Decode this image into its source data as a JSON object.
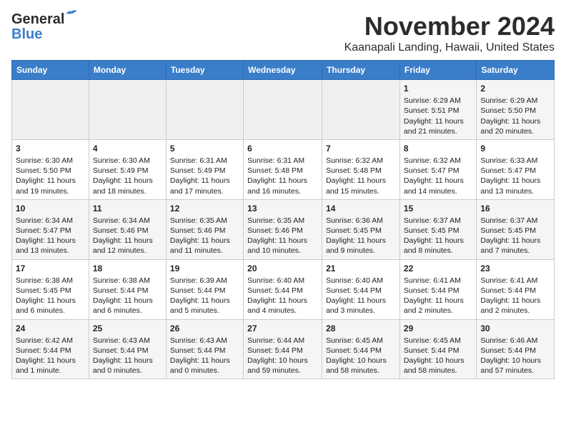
{
  "logo": {
    "line1": "General",
    "line2": "Blue"
  },
  "header": {
    "month": "November 2024",
    "location": "Kaanapali Landing, Hawaii, United States"
  },
  "columns": [
    "Sunday",
    "Monday",
    "Tuesday",
    "Wednesday",
    "Thursday",
    "Friday",
    "Saturday"
  ],
  "weeks": [
    [
      {
        "day": "",
        "empty": true
      },
      {
        "day": "",
        "empty": true
      },
      {
        "day": "",
        "empty": true
      },
      {
        "day": "",
        "empty": true
      },
      {
        "day": "",
        "empty": true
      },
      {
        "day": "1",
        "sunrise": "6:29 AM",
        "sunset": "5:51 PM",
        "daylight": "11 hours and 21 minutes."
      },
      {
        "day": "2",
        "sunrise": "6:29 AM",
        "sunset": "5:50 PM",
        "daylight": "11 hours and 20 minutes."
      }
    ],
    [
      {
        "day": "3",
        "sunrise": "6:30 AM",
        "sunset": "5:50 PM",
        "daylight": "11 hours and 19 minutes."
      },
      {
        "day": "4",
        "sunrise": "6:30 AM",
        "sunset": "5:49 PM",
        "daylight": "11 hours and 18 minutes."
      },
      {
        "day": "5",
        "sunrise": "6:31 AM",
        "sunset": "5:49 PM",
        "daylight": "11 hours and 17 minutes."
      },
      {
        "day": "6",
        "sunrise": "6:31 AM",
        "sunset": "5:48 PM",
        "daylight": "11 hours and 16 minutes."
      },
      {
        "day": "7",
        "sunrise": "6:32 AM",
        "sunset": "5:48 PM",
        "daylight": "11 hours and 15 minutes."
      },
      {
        "day": "8",
        "sunrise": "6:32 AM",
        "sunset": "5:47 PM",
        "daylight": "11 hours and 14 minutes."
      },
      {
        "day": "9",
        "sunrise": "6:33 AM",
        "sunset": "5:47 PM",
        "daylight": "11 hours and 13 minutes."
      }
    ],
    [
      {
        "day": "10",
        "sunrise": "6:34 AM",
        "sunset": "5:47 PM",
        "daylight": "11 hours and 13 minutes."
      },
      {
        "day": "11",
        "sunrise": "6:34 AM",
        "sunset": "5:46 PM",
        "daylight": "11 hours and 12 minutes."
      },
      {
        "day": "12",
        "sunrise": "6:35 AM",
        "sunset": "5:46 PM",
        "daylight": "11 hours and 11 minutes."
      },
      {
        "day": "13",
        "sunrise": "6:35 AM",
        "sunset": "5:46 PM",
        "daylight": "11 hours and 10 minutes."
      },
      {
        "day": "14",
        "sunrise": "6:36 AM",
        "sunset": "5:45 PM",
        "daylight": "11 hours and 9 minutes."
      },
      {
        "day": "15",
        "sunrise": "6:37 AM",
        "sunset": "5:45 PM",
        "daylight": "11 hours and 8 minutes."
      },
      {
        "day": "16",
        "sunrise": "6:37 AM",
        "sunset": "5:45 PM",
        "daylight": "11 hours and 7 minutes."
      }
    ],
    [
      {
        "day": "17",
        "sunrise": "6:38 AM",
        "sunset": "5:45 PM",
        "daylight": "11 hours and 6 minutes."
      },
      {
        "day": "18",
        "sunrise": "6:38 AM",
        "sunset": "5:44 PM",
        "daylight": "11 hours and 6 minutes."
      },
      {
        "day": "19",
        "sunrise": "6:39 AM",
        "sunset": "5:44 PM",
        "daylight": "11 hours and 5 minutes."
      },
      {
        "day": "20",
        "sunrise": "6:40 AM",
        "sunset": "5:44 PM",
        "daylight": "11 hours and 4 minutes."
      },
      {
        "day": "21",
        "sunrise": "6:40 AM",
        "sunset": "5:44 PM",
        "daylight": "11 hours and 3 minutes."
      },
      {
        "day": "22",
        "sunrise": "6:41 AM",
        "sunset": "5:44 PM",
        "daylight": "11 hours and 2 minutes."
      },
      {
        "day": "23",
        "sunrise": "6:41 AM",
        "sunset": "5:44 PM",
        "daylight": "11 hours and 2 minutes."
      }
    ],
    [
      {
        "day": "24",
        "sunrise": "6:42 AM",
        "sunset": "5:44 PM",
        "daylight": "11 hours and 1 minute."
      },
      {
        "day": "25",
        "sunrise": "6:43 AM",
        "sunset": "5:44 PM",
        "daylight": "11 hours and 0 minutes."
      },
      {
        "day": "26",
        "sunrise": "6:43 AM",
        "sunset": "5:44 PM",
        "daylight": "11 hours and 0 minutes."
      },
      {
        "day": "27",
        "sunrise": "6:44 AM",
        "sunset": "5:44 PM",
        "daylight": "10 hours and 59 minutes."
      },
      {
        "day": "28",
        "sunrise": "6:45 AM",
        "sunset": "5:44 PM",
        "daylight": "10 hours and 58 minutes."
      },
      {
        "day": "29",
        "sunrise": "6:45 AM",
        "sunset": "5:44 PM",
        "daylight": "10 hours and 58 minutes."
      },
      {
        "day": "30",
        "sunrise": "6:46 AM",
        "sunset": "5:44 PM",
        "daylight": "10 hours and 57 minutes."
      }
    ]
  ]
}
